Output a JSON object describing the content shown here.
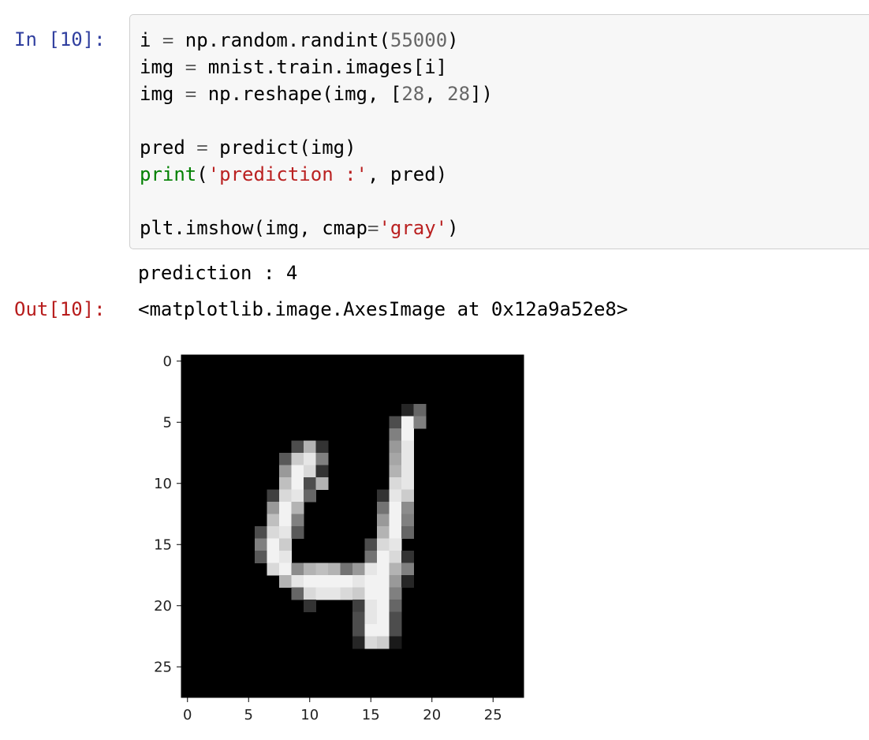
{
  "input_cell": {
    "prompt": "In [10]:",
    "code_lines": [
      [
        {
          "t": "i "
        },
        {
          "t": "=",
          "c": "op"
        },
        {
          "t": " np.random.randint("
        },
        {
          "t": "55000",
          "c": "num"
        },
        {
          "t": ")"
        }
      ],
      [
        {
          "t": "img "
        },
        {
          "t": "=",
          "c": "op"
        },
        {
          "t": " mnist.train.images[i]"
        }
      ],
      [
        {
          "t": "img "
        },
        {
          "t": "=",
          "c": "op"
        },
        {
          "t": " np.reshape(img, ["
        },
        {
          "t": "28",
          "c": "num"
        },
        {
          "t": ", "
        },
        {
          "t": "28",
          "c": "num"
        },
        {
          "t": "])"
        }
      ],
      [],
      [
        {
          "t": "pred "
        },
        {
          "t": "=",
          "c": "op"
        },
        {
          "t": " predict(img)"
        }
      ],
      [
        {
          "t": "print",
          "c": "builtin"
        },
        {
          "t": "("
        },
        {
          "t": "'prediction :'",
          "c": "str"
        },
        {
          "t": ", pred)"
        }
      ],
      [],
      [
        {
          "t": "plt.imshow(img, cmap"
        },
        {
          "t": "=",
          "c": "op"
        },
        {
          "t": "'gray'",
          "c": "str"
        },
        {
          "t": ")"
        }
      ]
    ]
  },
  "output": {
    "stdout": "prediction : 4",
    "prompt": "Out[10]:",
    "repr": "<matplotlib.image.AxesImage at 0x12a9a52e8>"
  },
  "chart_data": {
    "type": "heatmap",
    "title": "",
    "xlabel": "",
    "ylabel": "",
    "colormap": "gray",
    "background": "#000000",
    "xlim": [
      -0.5,
      27.5
    ],
    "ylim": [
      27.5,
      -0.5
    ],
    "x_ticks": [
      0,
      5,
      10,
      15,
      20,
      25
    ],
    "y_ticks": [
      0,
      5,
      10,
      15,
      20,
      25
    ],
    "tick_labels_x": [
      "0",
      "5",
      "10",
      "15",
      "20",
      "25"
    ],
    "tick_labels_y": [
      "0",
      "5",
      "10",
      "15",
      "20",
      "25"
    ],
    "shape": [
      28,
      28
    ],
    "pixels": [
      [
        4,
        18,
        0.15
      ],
      [
        4,
        19,
        0.4
      ],
      [
        5,
        17,
        0.3
      ],
      [
        5,
        18,
        0.95
      ],
      [
        5,
        19,
        0.5
      ],
      [
        6,
        17,
        0.5
      ],
      [
        6,
        18,
        0.95
      ],
      [
        7,
        9,
        0.3
      ],
      [
        7,
        10,
        0.7
      ],
      [
        7,
        11,
        0.2
      ],
      [
        7,
        17,
        0.6
      ],
      [
        7,
        18,
        0.9
      ],
      [
        8,
        8,
        0.35
      ],
      [
        8,
        9,
        0.8
      ],
      [
        8,
        10,
        0.9
      ],
      [
        8,
        11,
        0.5
      ],
      [
        8,
        17,
        0.65
      ],
      [
        8,
        18,
        0.9
      ],
      [
        9,
        8,
        0.6
      ],
      [
        9,
        9,
        0.95
      ],
      [
        9,
        10,
        0.85
      ],
      [
        9,
        11,
        0.2
      ],
      [
        9,
        17,
        0.7
      ],
      [
        9,
        18,
        0.9
      ],
      [
        10,
        8,
        0.75
      ],
      [
        10,
        9,
        0.95
      ],
      [
        10,
        10,
        0.3
      ],
      [
        10,
        11,
        0.7
      ],
      [
        10,
        17,
        0.85
      ],
      [
        10,
        18,
        0.9
      ],
      [
        11,
        7,
        0.25
      ],
      [
        11,
        8,
        0.85
      ],
      [
        11,
        9,
        0.9
      ],
      [
        11,
        10,
        0.4
      ],
      [
        11,
        16,
        0.2
      ],
      [
        11,
        17,
        0.9
      ],
      [
        11,
        18,
        0.8
      ],
      [
        12,
        7,
        0.6
      ],
      [
        12,
        8,
        0.95
      ],
      [
        12,
        9,
        0.7
      ],
      [
        12,
        16,
        0.45
      ],
      [
        12,
        17,
        0.95
      ],
      [
        12,
        18,
        0.55
      ],
      [
        13,
        7,
        0.75
      ],
      [
        13,
        8,
        0.95
      ],
      [
        13,
        9,
        0.5
      ],
      [
        13,
        16,
        0.6
      ],
      [
        13,
        17,
        0.95
      ],
      [
        13,
        18,
        0.5
      ],
      [
        14,
        6,
        0.3
      ],
      [
        14,
        7,
        0.85
      ],
      [
        14,
        8,
        0.9
      ],
      [
        14,
        9,
        0.35
      ],
      [
        14,
        16,
        0.7
      ],
      [
        14,
        17,
        0.95
      ],
      [
        14,
        18,
        0.4
      ],
      [
        15,
        6,
        0.5
      ],
      [
        15,
        7,
        0.95
      ],
      [
        15,
        8,
        0.8
      ],
      [
        15,
        15,
        0.3
      ],
      [
        15,
        16,
        0.85
      ],
      [
        15,
        17,
        0.9
      ],
      [
        16,
        6,
        0.35
      ],
      [
        16,
        7,
        0.95
      ],
      [
        16,
        8,
        0.9
      ],
      [
        16,
        15,
        0.45
      ],
      [
        16,
        16,
        0.95
      ],
      [
        16,
        17,
        0.85
      ],
      [
        16,
        18,
        0.2
      ],
      [
        17,
        7,
        0.85
      ],
      [
        17,
        8,
        0.95
      ],
      [
        17,
        9,
        0.55
      ],
      [
        17,
        10,
        0.7
      ],
      [
        17,
        11,
        0.75
      ],
      [
        17,
        12,
        0.7
      ],
      [
        17,
        13,
        0.45
      ],
      [
        17,
        14,
        0.6
      ],
      [
        17,
        15,
        0.9
      ],
      [
        17,
        16,
        0.95
      ],
      [
        17,
        17,
        0.7
      ],
      [
        17,
        18,
        0.5
      ],
      [
        18,
        8,
        0.7
      ],
      [
        18,
        9,
        0.9
      ],
      [
        18,
        10,
        0.95
      ],
      [
        18,
        11,
        0.95
      ],
      [
        18,
        12,
        0.95
      ],
      [
        18,
        13,
        0.95
      ],
      [
        18,
        14,
        0.9
      ],
      [
        18,
        15,
        0.95
      ],
      [
        18,
        16,
        0.95
      ],
      [
        18,
        17,
        0.6
      ],
      [
        18,
        18,
        0.15
      ],
      [
        19,
        9,
        0.4
      ],
      [
        19,
        10,
        0.85
      ],
      [
        19,
        11,
        0.9
      ],
      [
        19,
        12,
        0.9
      ],
      [
        19,
        13,
        0.85
      ],
      [
        19,
        14,
        0.8
      ],
      [
        19,
        15,
        0.95
      ],
      [
        19,
        16,
        0.95
      ],
      [
        19,
        17,
        0.5
      ],
      [
        20,
        10,
        0.2
      ],
      [
        20,
        14,
        0.25
      ],
      [
        20,
        15,
        0.9
      ],
      [
        20,
        16,
        0.95
      ],
      [
        20,
        17,
        0.4
      ],
      [
        21,
        14,
        0.3
      ],
      [
        21,
        15,
        0.9
      ],
      [
        21,
        16,
        0.95
      ],
      [
        21,
        17,
        0.3
      ],
      [
        22,
        14,
        0.3
      ],
      [
        22,
        15,
        0.95
      ],
      [
        22,
        16,
        0.95
      ],
      [
        22,
        17,
        0.3
      ],
      [
        23,
        14,
        0.15
      ],
      [
        23,
        15,
        0.85
      ],
      [
        23,
        16,
        0.8
      ],
      [
        23,
        17,
        0.1
      ]
    ]
  }
}
